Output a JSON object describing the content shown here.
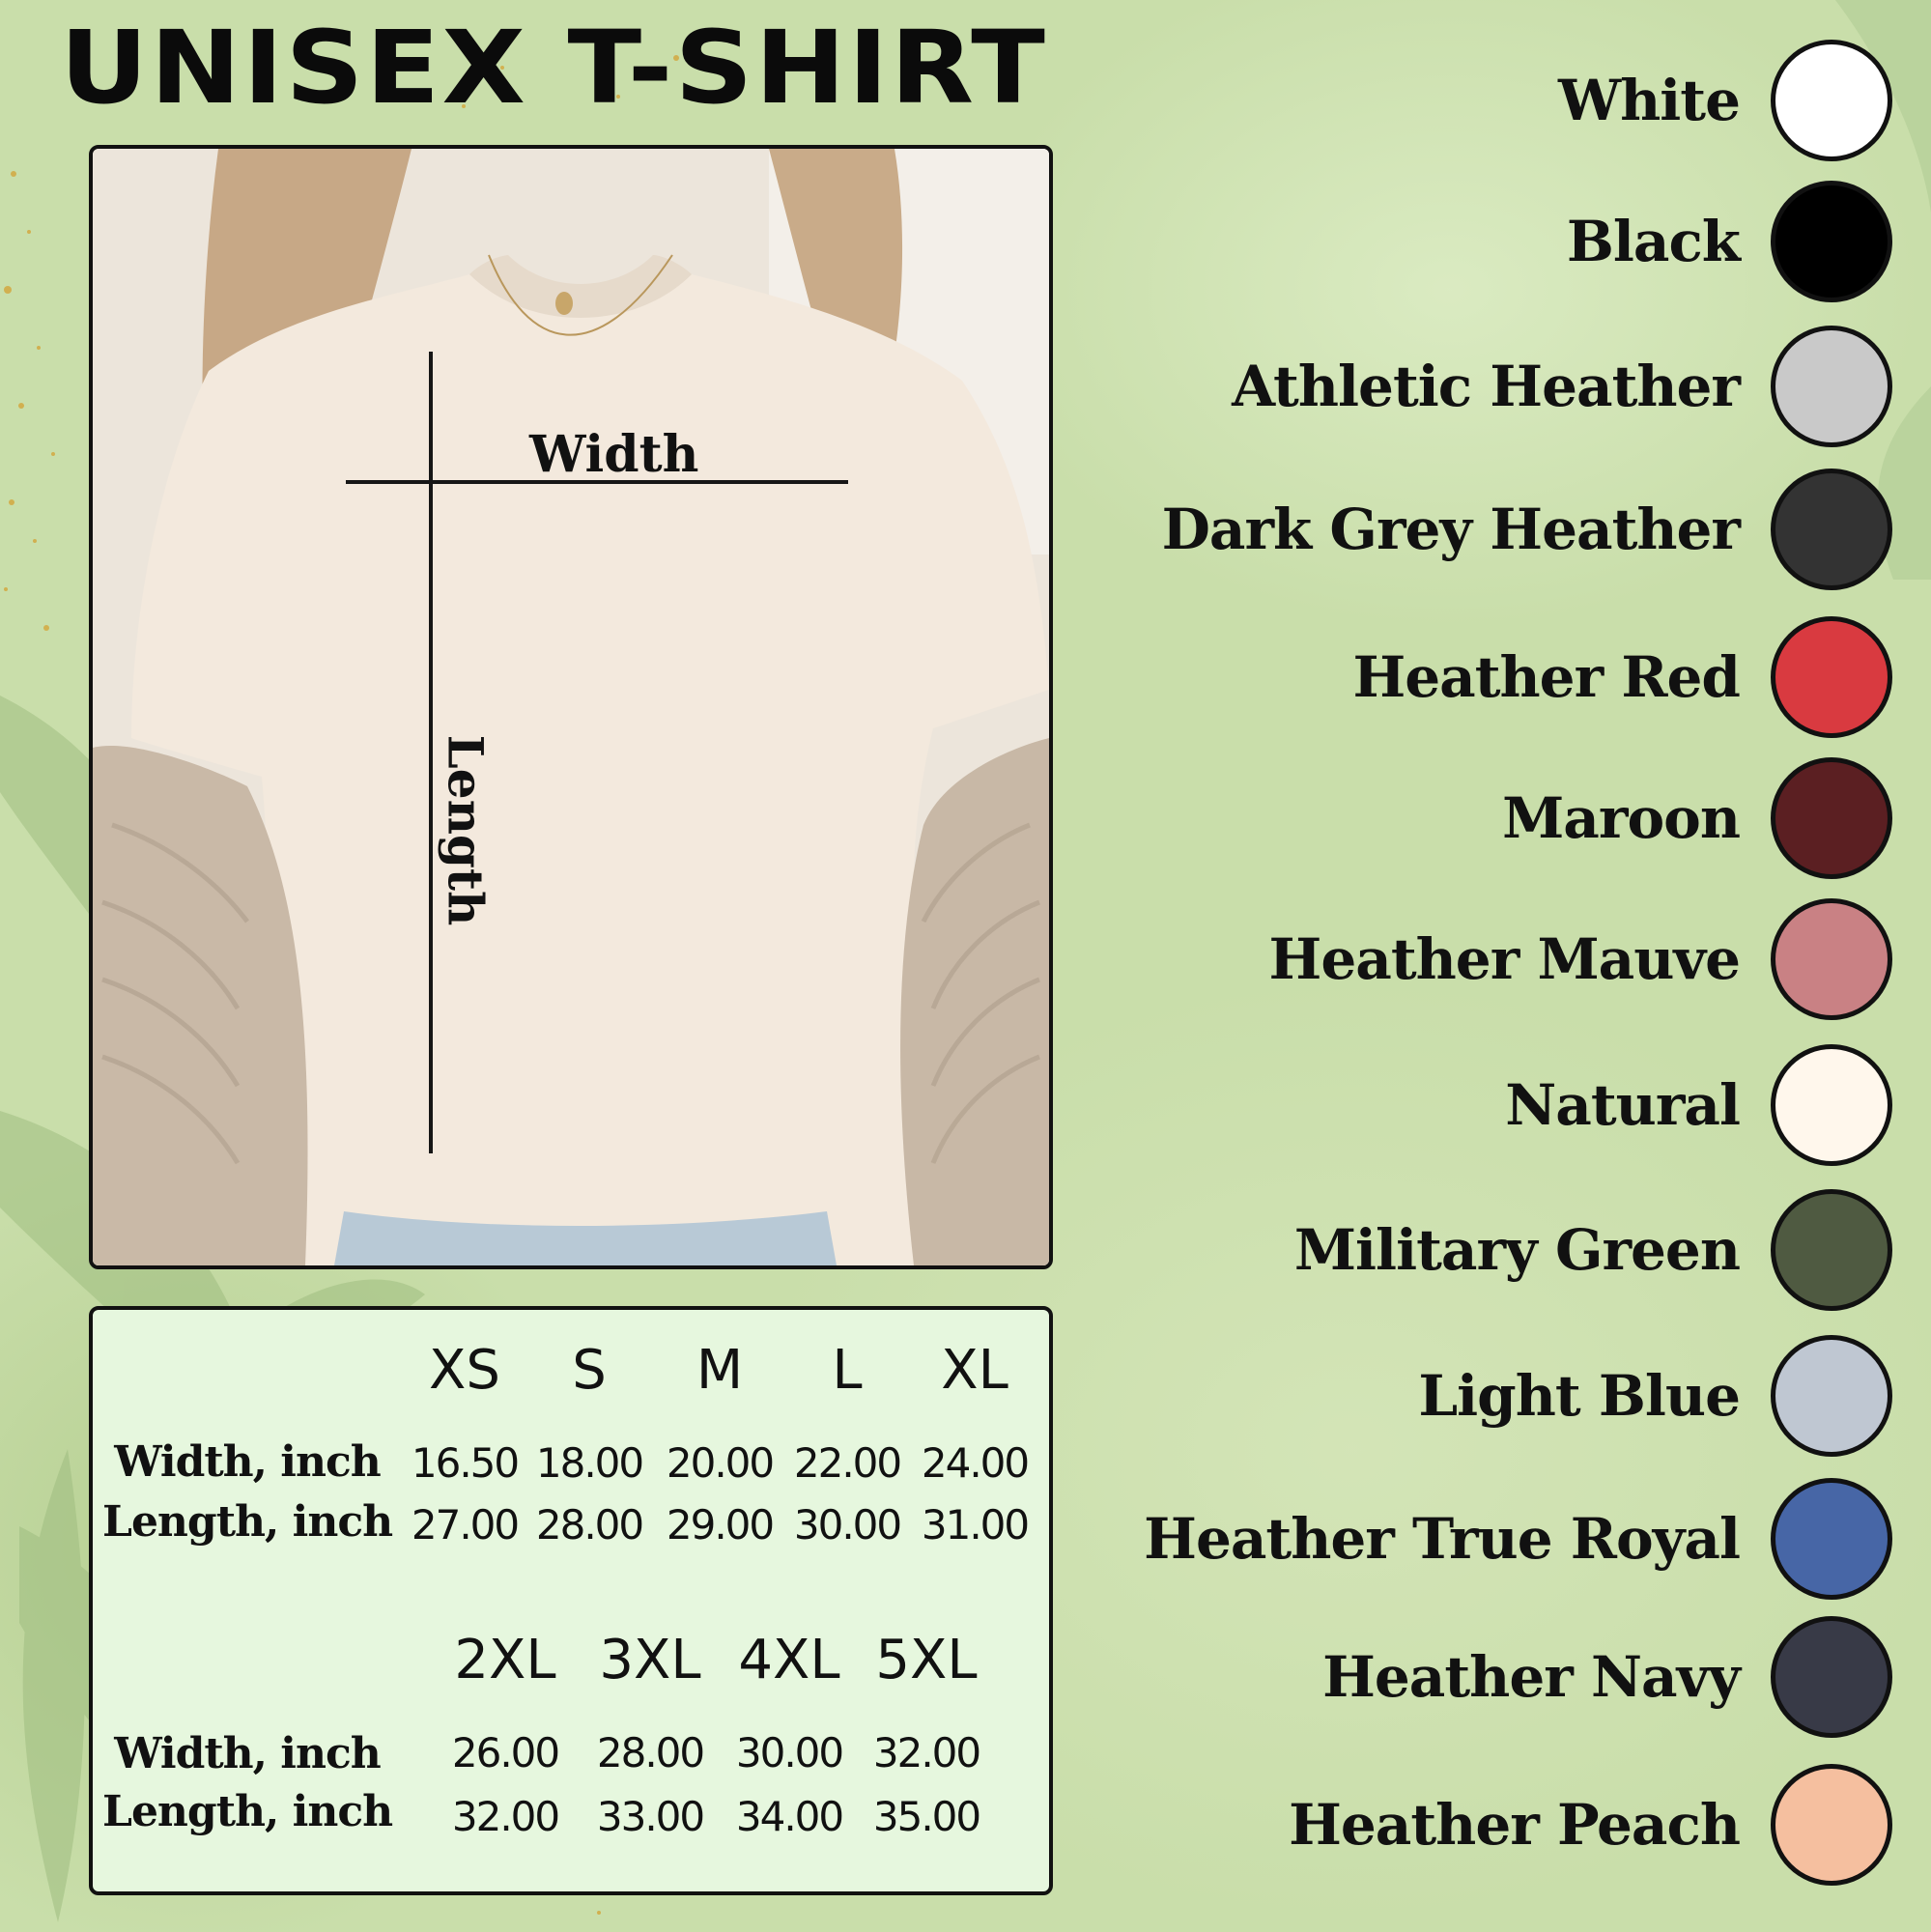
{
  "title": "UNISEX T-SHIRT",
  "photo": {
    "width_label": "Width",
    "length_label": "Length"
  },
  "size_table": {
    "group1": {
      "sizes": [
        "XS",
        "S",
        "M",
        "L",
        "XL"
      ],
      "width_label": "Width, inch",
      "length_label": "Length, inch",
      "width": [
        "16.50",
        "18.00",
        "20.00",
        "22.00",
        "24.00"
      ],
      "length": [
        "27.00",
        "28.00",
        "29.00",
        "30.00",
        "31.00"
      ]
    },
    "group2": {
      "sizes": [
        "2XL",
        "3XL",
        "4XL",
        "5XL"
      ],
      "width_label": "Width, inch",
      "length_label": "Length, inch",
      "width": [
        "26.00",
        "28.00",
        "30.00",
        "32.00"
      ],
      "length": [
        "32.00",
        "33.00",
        "34.00",
        "35.00"
      ]
    }
  },
  "colors": [
    {
      "name": "White",
      "hex": "#ffffff"
    },
    {
      "name": "Black",
      "hex": "#000000"
    },
    {
      "name": "Athletic Heather",
      "hex": "#c9c9c9"
    },
    {
      "name": "Dark Grey Heather",
      "hex": "#333333"
    },
    {
      "name": "Heather Red",
      "hex": "#d93a40"
    },
    {
      "name": "Maroon",
      "hex": "#5b1f22"
    },
    {
      "name": "Heather Mauve",
      "hex": "#c98184"
    },
    {
      "name": "Natural",
      "hex": "#fff7ec"
    },
    {
      "name": "Military Green",
      "hex": "#4f5a41"
    },
    {
      "name": "Light Blue",
      "hex": "#bfc7d2"
    },
    {
      "name": "Heather True Royal",
      "hex": "#4766a6"
    },
    {
      "name": "Heather Navy",
      "hex": "#383a47"
    },
    {
      "name": "Heather Peach",
      "hex": "#f5bf9f"
    }
  ]
}
